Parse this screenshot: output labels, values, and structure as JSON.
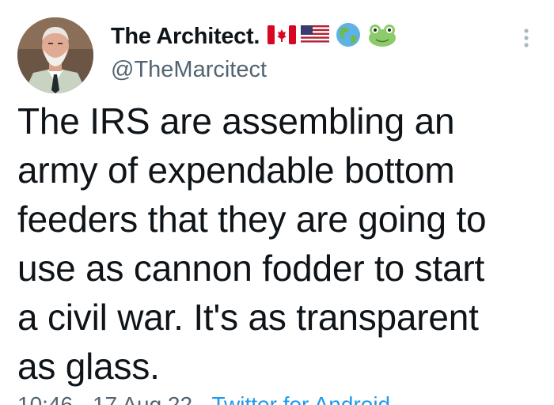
{
  "tweet": {
    "display_name": "The Architect.",
    "handle": "@TheMarcitect",
    "badges": [
      "canada-flag-icon",
      "usa-flag-icon",
      "globe-icon",
      "frog-icon"
    ],
    "text_lines": [
      "The IRS are assembling an",
      "army of expendable bottom",
      "feeders that they are going to",
      "use as cannon fodder to start",
      "a civil war. It's as transparent",
      "as glass."
    ],
    "meta_time": "10:46 · 17 Aug 22 ·",
    "meta_source": "Twitter for Android"
  },
  "colors": {
    "text": "#0f1419",
    "secondary": "#536471",
    "link": "#1d9bf0"
  }
}
